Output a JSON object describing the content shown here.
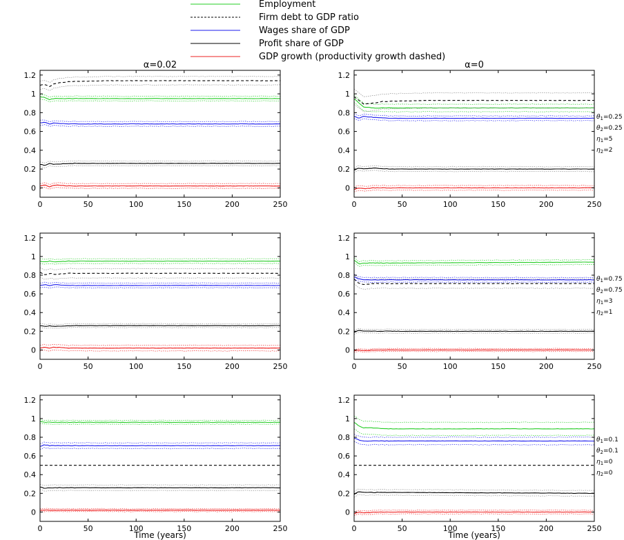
{
  "legend": [
    {
      "label": "Employment",
      "color": "#22cc22",
      "dash": false
    },
    {
      "label": "Firm debt to GDP ratio",
      "color": "#000000",
      "dash": true
    },
    {
      "label": "Wages share of GDP",
      "color": "#1a1aee",
      "dash": false
    },
    {
      "label": "Profit share of GDP",
      "color": "#000000",
      "dash": false
    },
    {
      "label": "GDP growth (productivity growth dashed)",
      "color": "#ee2222",
      "dash": false
    }
  ],
  "colors": {
    "employment": "#22cc22",
    "debt": "#000000",
    "wages": "#1a1aee",
    "profit": "#000000",
    "growth": "#ee2222",
    "band": "#888888"
  },
  "column_titles": [
    "α=0.02",
    "α=0"
  ],
  "xlabel": "Time (years)",
  "row_params": [
    [
      {
        "sym": "θ",
        "sub": "1",
        "val": "=0.25"
      },
      {
        "sym": "θ",
        "sub": "2",
        "val": "=0.25"
      },
      {
        "sym": "η",
        "sub": "1",
        "val": "=5"
      },
      {
        "sym": "η",
        "sub": "2",
        "val": "=2"
      }
    ],
    [
      {
        "sym": "θ",
        "sub": "1",
        "val": "=0.75"
      },
      {
        "sym": "θ",
        "sub": "2",
        "val": "=0.75"
      },
      {
        "sym": "η",
        "sub": "1",
        "val": "=3"
      },
      {
        "sym": "η",
        "sub": "2",
        "val": "=1"
      }
    ],
    [
      {
        "sym": "θ",
        "sub": "1",
        "val": "=0.1"
      },
      {
        "sym": "θ",
        "sub": "2",
        "val": "=0.1"
      },
      {
        "sym": "η",
        "sub": "1",
        "val": "=0"
      },
      {
        "sym": "η",
        "sub": "2",
        "val": "=0"
      }
    ]
  ],
  "chart_data": [
    {
      "type": "line",
      "panel": "row1-col1",
      "title": "α=0.02",
      "xlim": [
        0,
        250
      ],
      "ylim": [
        -0.1,
        1.25
      ],
      "xticks": [
        0,
        50,
        100,
        150,
        200,
        250
      ],
      "yticks": [
        0,
        0.2,
        0.4,
        0.6,
        0.8,
        1,
        1.2
      ],
      "series": [
        {
          "name": "Employment",
          "points": [
            [
              0,
              0.97
            ],
            [
              5,
              0.96
            ],
            [
              10,
              0.94
            ],
            [
              15,
              0.95
            ],
            [
              30,
              0.95
            ],
            [
              250,
              0.95
            ]
          ],
          "band": 0.025
        },
        {
          "name": "Firm debt to GDP ratio",
          "points": [
            [
              0,
              1.09
            ],
            [
              5,
              1.1
            ],
            [
              10,
              1.08
            ],
            [
              15,
              1.11
            ],
            [
              30,
              1.13
            ],
            [
              70,
              1.14
            ],
            [
              250,
              1.14
            ]
          ],
          "band": 0.045
        },
        {
          "name": "Wages share of GDP",
          "points": [
            [
              0,
              0.69
            ],
            [
              5,
              0.7
            ],
            [
              10,
              0.68
            ],
            [
              15,
              0.69
            ],
            [
              30,
              0.68
            ],
            [
              250,
              0.68
            ]
          ],
          "band": 0.025
        },
        {
          "name": "Profit share of GDP",
          "points": [
            [
              0,
              0.25
            ],
            [
              5,
              0.24
            ],
            [
              10,
              0.26
            ],
            [
              15,
              0.25
            ],
            [
              30,
              0.26
            ],
            [
              250,
              0.26
            ]
          ],
          "band": 0.025
        },
        {
          "name": "GDP growth",
          "points": [
            [
              0,
              0.02
            ],
            [
              5,
              0.03
            ],
            [
              10,
              0.01
            ],
            [
              15,
              0.03
            ],
            [
              30,
              0.02
            ],
            [
              250,
              0.02
            ]
          ],
          "band": 0.025
        }
      ]
    },
    {
      "type": "line",
      "panel": "row1-col2",
      "title": "α=0",
      "xlim": [
        0,
        250
      ],
      "ylim": [
        -0.1,
        1.25
      ],
      "xticks": [
        0,
        50,
        100,
        150,
        200,
        250
      ],
      "yticks": [
        0,
        0.2,
        0.4,
        0.6,
        0.8,
        1,
        1.2
      ],
      "series": [
        {
          "name": "Employment",
          "points": [
            [
              0,
              0.95
            ],
            [
              5,
              0.9
            ],
            [
              10,
              0.86
            ],
            [
              20,
              0.85
            ],
            [
              40,
              0.85
            ],
            [
              250,
              0.85
            ]
          ],
          "band": 0.04
        },
        {
          "name": "Firm debt to GDP ratio",
          "points": [
            [
              0,
              0.97
            ],
            [
              5,
              0.93
            ],
            [
              10,
              0.89
            ],
            [
              20,
              0.9
            ],
            [
              30,
              0.92
            ],
            [
              80,
              0.93
            ],
            [
              250,
              0.93
            ]
          ],
          "band": 0.08
        },
        {
          "name": "Wages share of GDP",
          "points": [
            [
              0,
              0.76
            ],
            [
              5,
              0.74
            ],
            [
              10,
              0.76
            ],
            [
              20,
              0.75
            ],
            [
              40,
              0.74
            ],
            [
              250,
              0.74
            ]
          ],
          "band": 0.025
        },
        {
          "name": "Profit share of GDP",
          "points": [
            [
              0,
              0.19
            ],
            [
              5,
              0.21
            ],
            [
              10,
              0.2
            ],
            [
              20,
              0.21
            ],
            [
              40,
              0.2
            ],
            [
              250,
              0.2
            ]
          ],
          "band": 0.025
        },
        {
          "name": "GDP growth",
          "points": [
            [
              0,
              -0.02
            ],
            [
              5,
              0.0
            ],
            [
              10,
              -0.01
            ],
            [
              20,
              0.0
            ],
            [
              40,
              0.0
            ],
            [
              250,
              0.0
            ]
          ],
          "band": 0.025
        }
      ]
    },
    {
      "type": "line",
      "panel": "row2-col1",
      "title": "",
      "xlim": [
        0,
        250
      ],
      "ylim": [
        -0.1,
        1.25
      ],
      "xticks": [
        0,
        50,
        100,
        150,
        200,
        250
      ],
      "yticks": [
        0,
        0.2,
        0.4,
        0.6,
        0.8,
        1,
        1.2
      ],
      "series": [
        {
          "name": "Employment",
          "points": [
            [
              0,
              0.95
            ],
            [
              5,
              0.94
            ],
            [
              10,
              0.95
            ],
            [
              15,
              0.94
            ],
            [
              30,
              0.95
            ],
            [
              250,
              0.95
            ]
          ],
          "band": 0.025
        },
        {
          "name": "Firm debt to GDP ratio",
          "points": [
            [
              0,
              0.83
            ],
            [
              5,
              0.8
            ],
            [
              10,
              0.82
            ],
            [
              15,
              0.81
            ],
            [
              30,
              0.82
            ],
            [
              250,
              0.82
            ]
          ],
          "band": 0.05
        },
        {
          "name": "Wages share of GDP",
          "points": [
            [
              0,
              0.69
            ],
            [
              5,
              0.7
            ],
            [
              10,
              0.69
            ],
            [
              15,
              0.7
            ],
            [
              30,
              0.69
            ],
            [
              250,
              0.69
            ]
          ],
          "band": 0.025
        },
        {
          "name": "Profit share of GDP",
          "points": [
            [
              0,
              0.26
            ],
            [
              5,
              0.25
            ],
            [
              10,
              0.26
            ],
            [
              15,
              0.25
            ],
            [
              30,
              0.26
            ],
            [
              250,
              0.26
            ]
          ],
          "band": 0.02
        },
        {
          "name": "GDP growth",
          "points": [
            [
              0,
              0.02
            ],
            [
              5,
              0.03
            ],
            [
              10,
              0.02
            ],
            [
              15,
              0.03
            ],
            [
              30,
              0.02
            ],
            [
              250,
              0.02
            ]
          ],
          "band": 0.03
        }
      ]
    },
    {
      "type": "line",
      "panel": "row2-col2",
      "title": "",
      "xlim": [
        0,
        250
      ],
      "ylim": [
        -0.1,
        1.25
      ],
      "xticks": [
        0,
        50,
        100,
        150,
        200,
        250
      ],
      "yticks": [
        0,
        0.2,
        0.4,
        0.6,
        0.8,
        1,
        1.2
      ],
      "series": [
        {
          "name": "Employment",
          "points": [
            [
              0,
              0.96
            ],
            [
              5,
              0.92
            ],
            [
              10,
              0.93
            ],
            [
              20,
              0.93
            ],
            [
              40,
              0.93
            ],
            [
              250,
              0.94
            ]
          ],
          "band": 0.025
        },
        {
          "name": "Firm debt to GDP ratio",
          "points": [
            [
              0,
              0.76
            ],
            [
              5,
              0.71
            ],
            [
              10,
              0.7
            ],
            [
              20,
              0.71
            ],
            [
              40,
              0.71
            ],
            [
              250,
              0.71
            ]
          ],
          "band": 0.05
        },
        {
          "name": "Wages share of GDP",
          "points": [
            [
              0,
              0.78
            ],
            [
              5,
              0.76
            ],
            [
              10,
              0.75
            ],
            [
              20,
              0.75
            ],
            [
              40,
              0.75
            ],
            [
              250,
              0.75
            ]
          ],
          "band": 0.025
        },
        {
          "name": "Profit share of GDP",
          "points": [
            [
              0,
              0.19
            ],
            [
              5,
              0.21
            ],
            [
              10,
              0.2
            ],
            [
              20,
              0.2
            ],
            [
              40,
              0.2
            ],
            [
              250,
              0.2
            ]
          ],
          "band": 0.02
        },
        {
          "name": "GDP growth",
          "points": [
            [
              0,
              -0.01
            ],
            [
              5,
              0.0
            ],
            [
              10,
              -0.01
            ],
            [
              20,
              0.0
            ],
            [
              40,
              0.0
            ],
            [
              250,
              0.0
            ]
          ],
          "band": 0.015
        }
      ]
    },
    {
      "type": "line",
      "panel": "row3-col1",
      "title": "",
      "xlim": [
        0,
        250
      ],
      "ylim": [
        -0.1,
        1.25
      ],
      "xticks": [
        0,
        50,
        100,
        150,
        200,
        250
      ],
      "yticks": [
        0,
        0.2,
        0.4,
        0.6,
        0.8,
        1,
        1.2
      ],
      "series": [
        {
          "name": "Employment",
          "points": [
            [
              0,
              0.97
            ],
            [
              5,
              0.96
            ],
            [
              10,
              0.96
            ],
            [
              20,
              0.96
            ],
            [
              40,
              0.96
            ],
            [
              250,
              0.96
            ]
          ],
          "band": 0.02
        },
        {
          "name": "Firm debt to GDP ratio",
          "points": [
            [
              0,
              0.5
            ],
            [
              250,
              0.5
            ]
          ],
          "band": 0
        },
        {
          "name": "Wages share of GDP",
          "points": [
            [
              0,
              0.7
            ],
            [
              5,
              0.72
            ],
            [
              10,
              0.71
            ],
            [
              20,
              0.71
            ],
            [
              40,
              0.71
            ],
            [
              250,
              0.71
            ]
          ],
          "band": 0.03
        },
        {
          "name": "Profit share of GDP",
          "points": [
            [
              0,
              0.27
            ],
            [
              5,
              0.25
            ],
            [
              10,
              0.26
            ],
            [
              20,
              0.26
            ],
            [
              40,
              0.26
            ],
            [
              250,
              0.26
            ]
          ],
          "band": 0.03
        },
        {
          "name": "GDP growth",
          "points": [
            [
              0,
              0.02
            ],
            [
              5,
              0.02
            ],
            [
              10,
              0.02
            ],
            [
              250,
              0.02
            ]
          ],
          "band": 0.015
        }
      ]
    },
    {
      "type": "line",
      "panel": "row3-col2",
      "title": "",
      "xlim": [
        0,
        250
      ],
      "ylim": [
        -0.1,
        1.25
      ],
      "xticks": [
        0,
        50,
        100,
        150,
        200,
        250
      ],
      "yticks": [
        0,
        0.2,
        0.4,
        0.6,
        0.8,
        1,
        1.2
      ],
      "series": [
        {
          "name": "Employment",
          "points": [
            [
              0,
              0.96
            ],
            [
              5,
              0.92
            ],
            [
              10,
              0.9
            ],
            [
              20,
              0.9
            ],
            [
              40,
              0.89
            ],
            [
              250,
              0.89
            ]
          ],
          "band": 0.07
        },
        {
          "name": "Firm debt to GDP ratio",
          "points": [
            [
              0,
              0.5
            ],
            [
              250,
              0.5
            ]
          ],
          "band": 0
        },
        {
          "name": "Wages share of GDP",
          "points": [
            [
              0,
              0.79
            ],
            [
              5,
              0.77
            ],
            [
              10,
              0.76
            ],
            [
              20,
              0.76
            ],
            [
              40,
              0.76
            ],
            [
              250,
              0.76
            ]
          ],
          "band": 0.04
        },
        {
          "name": "Profit share of GDP",
          "points": [
            [
              0,
              0.19
            ],
            [
              5,
              0.22
            ],
            [
              10,
              0.21
            ],
            [
              20,
              0.21
            ],
            [
              40,
              0.21
            ],
            [
              250,
              0.2
            ]
          ],
          "band": 0.03
        },
        {
          "name": "GDP growth",
          "points": [
            [
              0,
              -0.02
            ],
            [
              5,
              0.0
            ],
            [
              10,
              -0.01
            ],
            [
              20,
              0.0
            ],
            [
              40,
              0.0
            ],
            [
              250,
              0.0
            ]
          ],
          "band": 0.02
        }
      ]
    }
  ]
}
